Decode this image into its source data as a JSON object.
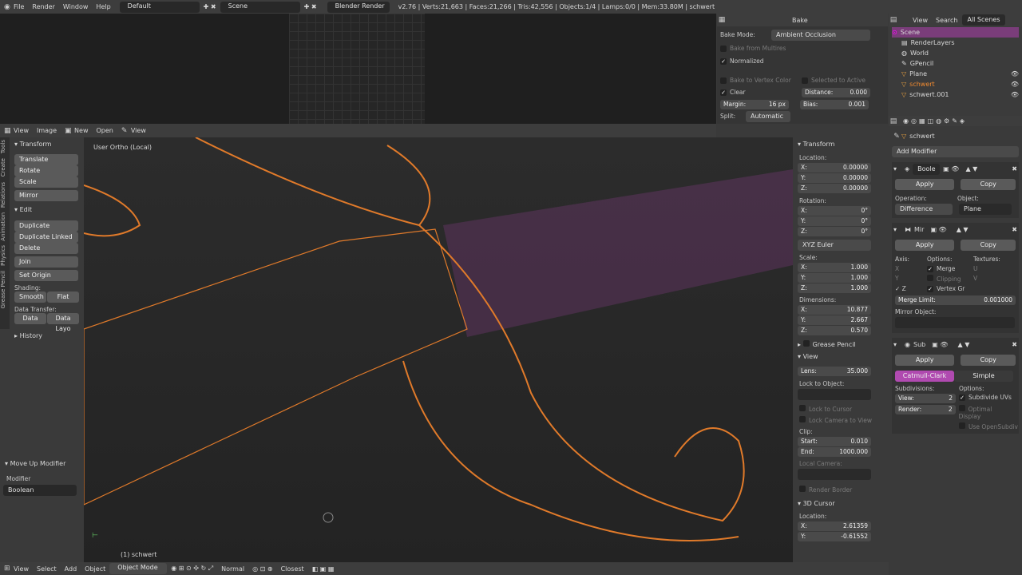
{
  "menu": {
    "items": [
      "File",
      "Render",
      "Window",
      "Help"
    ],
    "layout": "Default",
    "scene": "Scene",
    "engine": "Blender Render",
    "stats": "v2.76 | Verts:21,663 | Faces:21,266 | Tris:42,556 | Objects:1/4 | Lamps:0/0 | Mem:33.80M | schwert"
  },
  "image_editor": {
    "header": [
      "View",
      "Image",
      "New",
      "Open",
      "View"
    ]
  },
  "bake": {
    "title": "Bake",
    "mode_label": "Bake Mode:",
    "mode": "Ambient Occlusion",
    "from_multires": "Bake from Multires",
    "normalized": "Normalized",
    "to_vertex": "Bake to Vertex Color",
    "selected_active": "Selected to Active",
    "clear": "Clear",
    "distance_label": "Distance:",
    "distance": "0.000",
    "margin_label": "Margin:",
    "margin": "16 px",
    "bias_label": "Bias:",
    "bias": "0.001",
    "split_label": "Split:",
    "split": "Automatic"
  },
  "outliner": {
    "header": [
      "View",
      "Search",
      "All Scenes"
    ],
    "items": [
      "Scene",
      "RenderLayers",
      "World",
      "GPencil",
      "Plane",
      "schwert",
      "schwert.001"
    ]
  },
  "tools": {
    "tabs": [
      "Tools",
      "Create",
      "Relations",
      "Animation",
      "Physics",
      "Grease Pencil"
    ],
    "transform": "Transform",
    "translate": "Translate",
    "rotate": "Rotate",
    "scale": "Scale",
    "mirror": "Mirror",
    "edit": "Edit",
    "duplicate": "Duplicate",
    "duplicate_linked": "Duplicate Linked",
    "delete": "Delete",
    "join": "Join",
    "set_origin": "Set Origin",
    "shading": "Shading:",
    "smooth": "Smooth",
    "flat": "Flat",
    "data_transfer": "Data Transfer:",
    "data": "Data",
    "data_layo": "Data Layo",
    "history": "History",
    "op_title": "Move Up Modifier",
    "modifier_label": "Modifier",
    "modifier": "Boolean"
  },
  "viewport": {
    "label": "User Ortho (Local)",
    "object": "(1) schwert",
    "footer": [
      "View",
      "Select",
      "Add",
      "Object",
      "Object Mode",
      "Normal",
      "Closest"
    ]
  },
  "npanel": {
    "transform": "Transform",
    "location": "Location:",
    "loc": [
      "0.00000",
      "0.00000",
      "0.00000"
    ],
    "rotation": "Rotation:",
    "rot": [
      "0°",
      "0°",
      "0°"
    ],
    "euler": "XYZ Euler",
    "scale": "Scale:",
    "scl": [
      "1.000",
      "1.000",
      "1.000"
    ],
    "dimensions": "Dimensions:",
    "dim": [
      "10.877",
      "2.667",
      "0.570"
    ],
    "grease_pencil": "Grease Pencil",
    "view": "View",
    "lens_label": "Lens:",
    "lens": "35.000",
    "lock_object": "Lock to Object:",
    "lock_cursor": "Lock to Cursor",
    "lock_camera": "Lock Camera to View",
    "clip": "Clip:",
    "start_label": "Start:",
    "start": "0.010",
    "end_label": "End:",
    "end": "1000.000",
    "local_camera": "Local Camera:",
    "render_border": "Render Border",
    "cursor": "3D Cursor",
    "cursor_loc": "Location:",
    "cx": "2.61359",
    "cy": "-0.61552"
  },
  "props": {
    "object": "schwert",
    "add_modifier": "Add Modifier",
    "m1": {
      "name": "Boole",
      "apply": "Apply",
      "copy": "Copy",
      "operation_label": "Operation:",
      "object_label": "Object:",
      "operation": "Difference",
      "object": "Plane"
    },
    "m2": {
      "name": "Mir",
      "apply": "Apply",
      "copy": "Copy",
      "axis": "Axis:",
      "options": "Options:",
      "textures": "Textures:",
      "merge": "Merge",
      "clipping": "Clipping",
      "vertex_gr": "Vertex Gr",
      "merge_limit_label": "Merge Limit:",
      "merge_limit": "0.001000",
      "mirror_object": "Mirror Object:"
    },
    "m3": {
      "name": "Sub",
      "apply": "Apply",
      "copy": "Copy",
      "catmull": "Catmull-Clark",
      "simple": "Simple",
      "subdivisions": "Subdivisions:",
      "options": "Options:",
      "view_label": "View:",
      "view": "2",
      "render_label": "Render:",
      "render": "2",
      "subdivide_uvs": "Subdivide UVs",
      "optimal": "Optimal Display",
      "open_subdiv": "Use OpenSubdiv"
    }
  }
}
